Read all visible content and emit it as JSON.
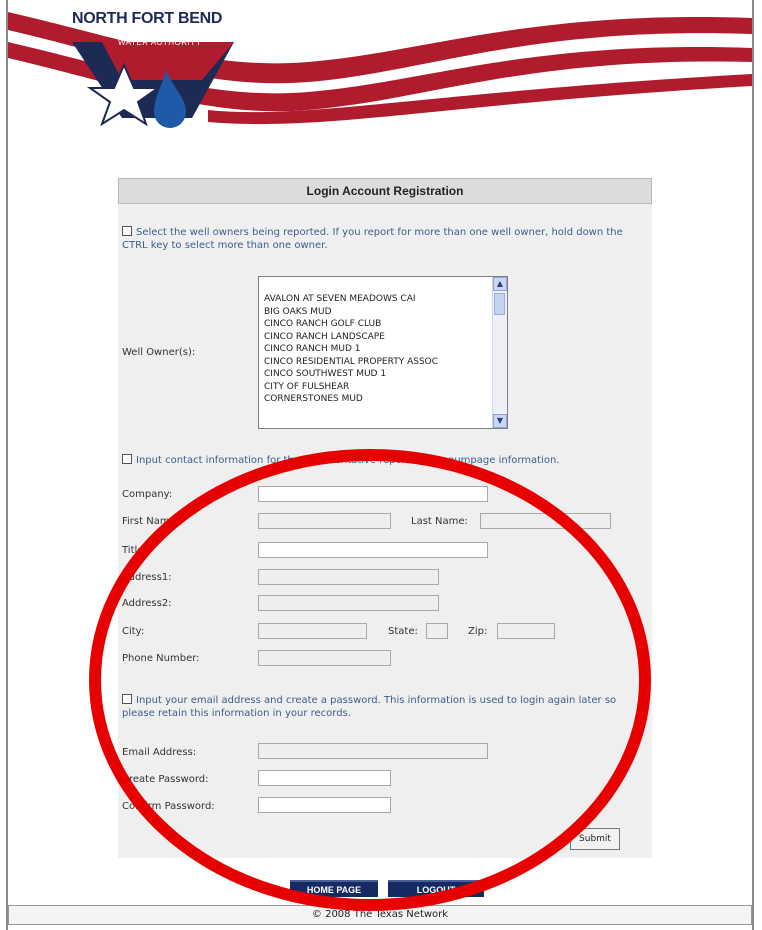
{
  "header": {
    "logo_line1": "NORTH FORT BEND",
    "logo_line2": "WATER AUTHORITY",
    "colors": {
      "stripe_red": "#b01c2e",
      "navy": "#1d2a55"
    }
  },
  "form": {
    "title": "Login Account Registration",
    "note1": "Select the well owners being reported. If you report for more than one well owner, hold down the CTRL key to select more than one owner.",
    "well_owner_label": "Well Owner(s):",
    "well_owners": [
      "AVALON AT SEVEN MEADOWS CAI",
      "BIG OAKS MUD",
      "CINCO RANCH GOLF CLUB",
      "CINCO RANCH LANDSCAPE",
      "CINCO RANCH MUD 1",
      "CINCO RESIDENTIAL PROPERTY ASSOC",
      "CINCO SOUTHWEST MUD 1",
      "CITY OF FULSHEAR",
      "CORNERSTONES MUD"
    ],
    "note2": "Input contact information for the representative reporting the pumpage information.",
    "labels": {
      "company": "Company:",
      "first_name": "First Name:",
      "last_name": "Last Name:",
      "title": "Title:",
      "address1": "Address1:",
      "address2": "Address2:",
      "city": "City:",
      "state": "State:",
      "zip": "Zip:",
      "phone": "Phone Number:",
      "email": "Email Address:",
      "create_password": "Create Password:",
      "confirm_password": "Confirm Password:"
    },
    "note3": "Input your email address and create a password. This information is used to login again later so please retain this information in your records.",
    "submit_label": "Submit"
  },
  "nav": {
    "home_label": "HOME PAGE",
    "logout_label": "LOGOUT"
  },
  "footer": {
    "text": "© 2008 The Texas Network"
  },
  "annotation": {
    "color": "#e60000"
  }
}
